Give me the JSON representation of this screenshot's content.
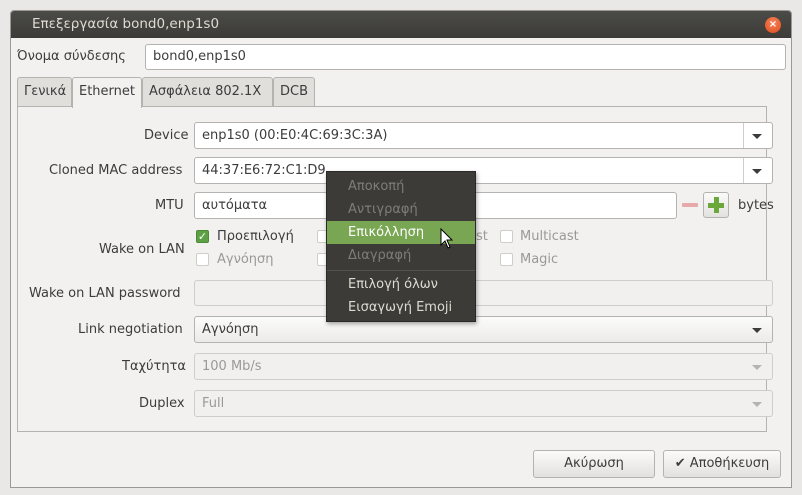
{
  "window": {
    "title": "Επεξεργασία bond0,enp1s0",
    "close_glyph": "×"
  },
  "connection_name": {
    "label": "Όνομα σύνδεσης",
    "value": "bond0,enp1s0"
  },
  "tabs": [
    {
      "label": "Γενικά"
    },
    {
      "label": "Ethernet"
    },
    {
      "label": "Ασφάλεια 802.1X"
    },
    {
      "label": "DCB"
    }
  ],
  "ethernet": {
    "device": {
      "label": "Device",
      "value": "enp1s0 (00:E0:4C:69:3C:3A)"
    },
    "cloned_mac": {
      "label": "Cloned MAC address",
      "value": "44:37:E6:72:C1:D9"
    },
    "mtu": {
      "label": "MTU",
      "value": "αυτόματα",
      "unit": "bytes",
      "minus": "−",
      "plus": "+"
    },
    "wake_on_lan": {
      "label": "Wake on LAN",
      "options": {
        "default": "Προεπιλογή",
        "ignore": "Αγνόηση",
        "broadcast_partial": "st",
        "multicast": "Multicast",
        "magic": "Magic"
      },
      "check_glyph": "✓"
    },
    "wol_password": {
      "label": "Wake on LAN password",
      "value": ""
    },
    "link_negotiation": {
      "label": "Link negotiation",
      "value": "Αγνόηση"
    },
    "speed": {
      "label": "Ταχύτητα",
      "value": "100 Mb/s"
    },
    "duplex": {
      "label": "Duplex",
      "value": "Full"
    }
  },
  "context_menu": {
    "items": [
      {
        "label": "Αποκοπή",
        "enabled": false
      },
      {
        "label": "Αντιγραφή",
        "enabled": false
      },
      {
        "label": "Επικόλληση",
        "enabled": true,
        "highlighted": true
      },
      {
        "label": "Διαγραφή",
        "enabled": false
      },
      {
        "label": "Επιλογή όλων",
        "enabled": true
      },
      {
        "label": "Εισαγωγή Emoji",
        "enabled": true
      }
    ]
  },
  "buttons": {
    "cancel": "Ακύρωση",
    "save": "Αποθήκευση",
    "save_glyph": "✔"
  },
  "colors": {
    "accent": "#79a653",
    "titlebar": "#3c3b37",
    "close": "#df4a16"
  }
}
